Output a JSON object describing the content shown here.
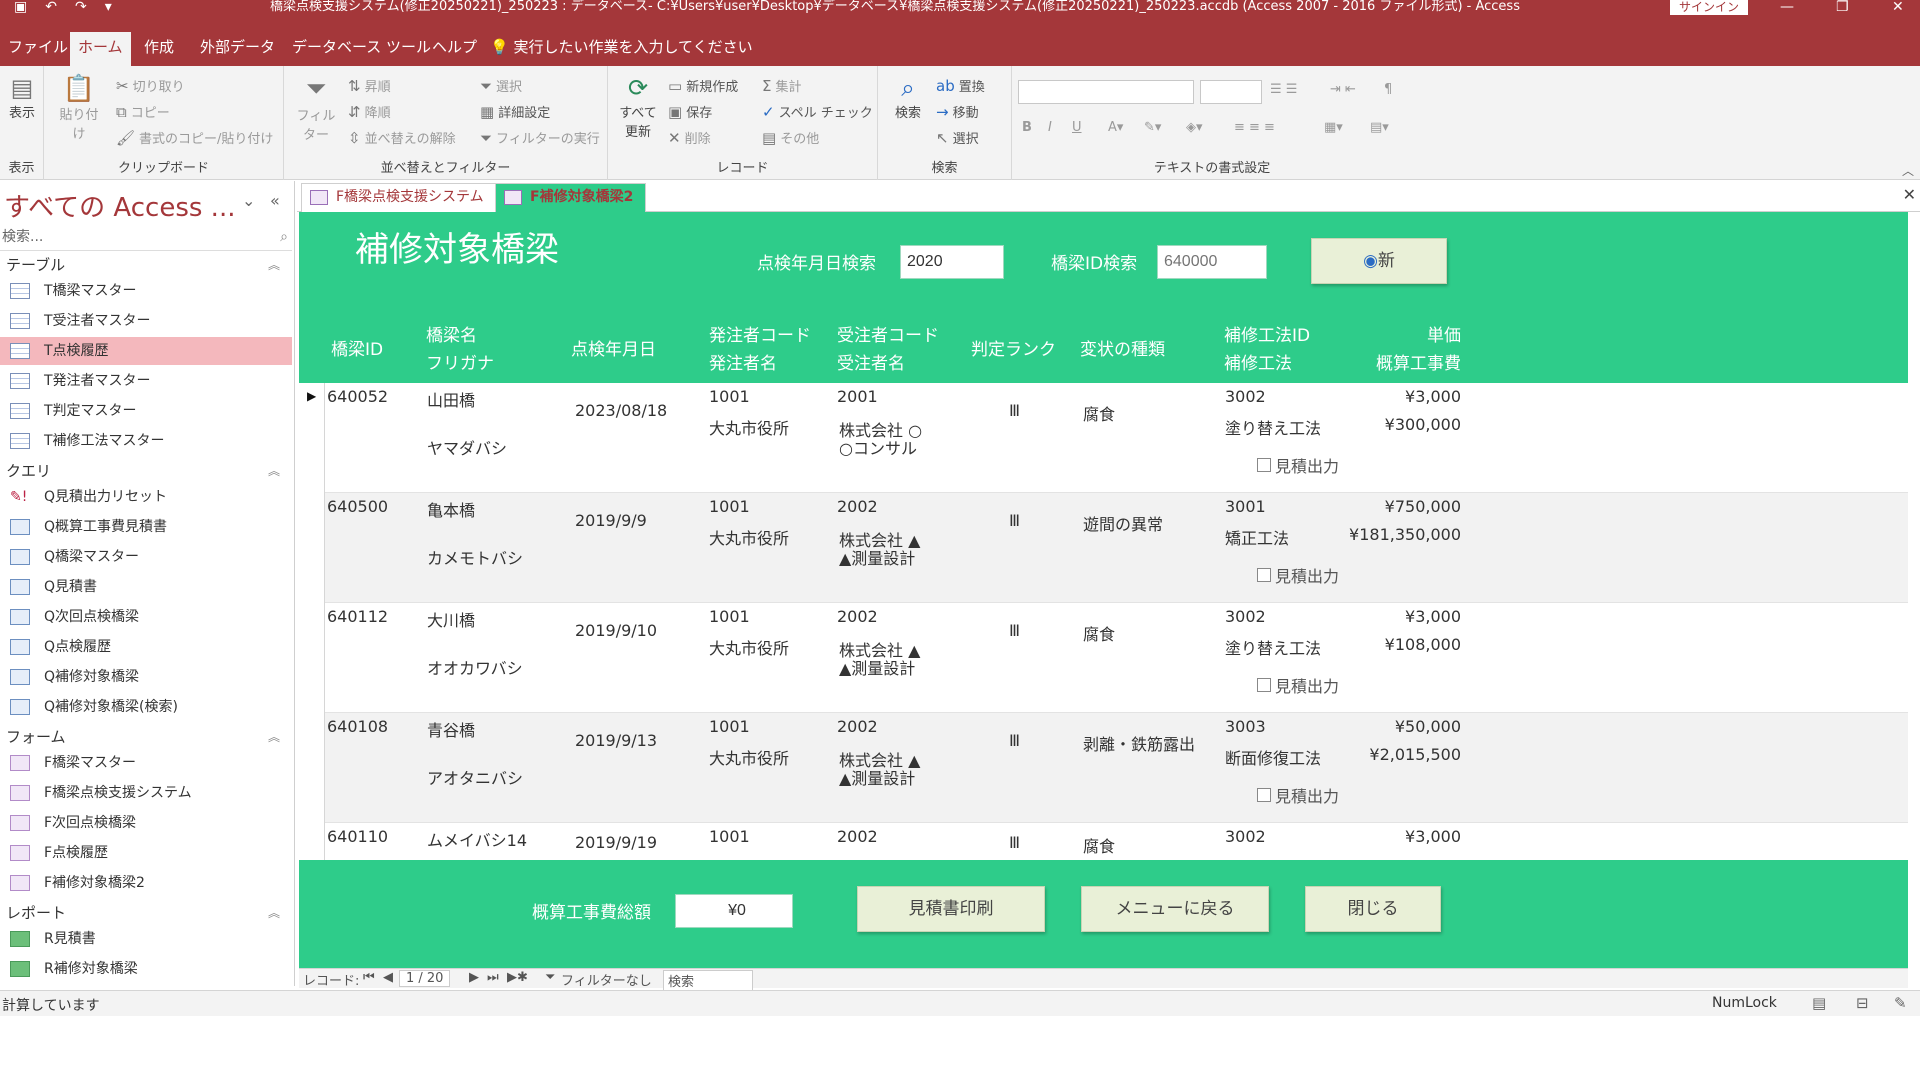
{
  "titlebar": {
    "title": "橋梁点検支援システム(修正20250221)_250223 : データベース- C:¥Users¥user¥Desktop¥データベース¥橋梁点検支援システム(修正20250221)_250223.accdb (Access 2007 - 2016 ファイル形式)  -  Access",
    "signin": "サインイン"
  },
  "menu": {
    "tabs": [
      "ファイル",
      "ホーム",
      "作成",
      "外部データ",
      "データベース ツール",
      "ヘルプ"
    ],
    "active": "ホーム",
    "tell_me": "実行したい作業を入力してください"
  },
  "ribbon": {
    "view": "表示",
    "paste": "貼り付け",
    "cut": "切り取り",
    "copy": "コピー",
    "format_painter": "書式のコピー/貼り付け",
    "filter": "フィルター",
    "ascending": "昇順",
    "descending": "降順",
    "remove_sort": "並べ替えの解除",
    "selection": "選択",
    "advanced": "詳細設定",
    "toggle_filter": "フィルターの実行",
    "refresh_all_1": "すべて",
    "refresh_all_2": "更新",
    "new": "新規作成",
    "save": "保存",
    "delete": "削除",
    "totals": "集計",
    "spelling": "スペル チェック",
    "more": "その他",
    "find": "検索",
    "replace": "置換",
    "goto": "移動",
    "select": "選択",
    "bold": "B",
    "italic": "I",
    "underline": "U",
    "groups": {
      "views": "表示",
      "clipboard": "クリップボード",
      "sort_filter": "並べ替えとフィルター",
      "records": "レコード",
      "find": "検索",
      "text_format": "テキストの書式設定"
    }
  },
  "nav": {
    "title": "すべての Access ...",
    "search_placeholder": "検索...",
    "sections": [
      {
        "label": "テーブル",
        "items": [
          "T橋梁マスター",
          "T受注者マスター",
          "T点検履歴",
          "T発注者マスター",
          "T判定マスター",
          "T補修工法マスター"
        ]
      },
      {
        "label": "クエリ",
        "items": [
          "Q見積出力リセット",
          "Q概算工事費見積書",
          "Q橋梁マスター",
          "Q見積書",
          "Q次回点検橋梁",
          "Q点検履歴",
          "Q補修対象橋梁",
          "Q補修対象橋梁(検索)"
        ]
      },
      {
        "label": "フォーム",
        "items": [
          "F橋梁マスター",
          "F橋梁点検支援システム",
          "F次回点検橋梁",
          "F点検履歴",
          "F補修対象橋梁2"
        ]
      },
      {
        "label": "レポート",
        "items": [
          "R見積書",
          "R補修対象橋梁"
        ]
      }
    ],
    "selected": "T点検履歴"
  },
  "doc_tabs": [
    {
      "label": "F橋梁点検支援システム",
      "active": false
    },
    {
      "label": "F補修対象橋梁2",
      "active": true
    }
  ],
  "form": {
    "title": "補修対象橋梁",
    "date_search_label": "点検年月日検索",
    "date_search_value": "2020",
    "id_search_label": "橋梁ID検索",
    "id_search_placeholder": "640000",
    "refresh_button": "新",
    "columns": {
      "bridge_id": "橋梁ID",
      "bridge_name": "橋梁名",
      "furigana": "フリガナ",
      "inspection_date": "点検年月日",
      "orderer_code": "発注者コード",
      "orderer_name": "発注者名",
      "contractor_code": "受注者コード",
      "contractor_name": "受注者名",
      "rank": "判定ランク",
      "defect": "変状の種類",
      "method_id": "補修工法ID",
      "method": "補修工法",
      "unit_price": "単価",
      "estimate": "概算工事費"
    },
    "estimate_checkbox": "見積出力",
    "rows": [
      {
        "id": "640052",
        "name": "山田橋",
        "furigana": "ヤマダバシ",
        "date": "2023/08/18",
        "orderer_code": "1001",
        "orderer": "大丸市役所",
        "contractor_code": "2001",
        "contractor_1": "株式会社 ○",
        "contractor_2": "○コンサル",
        "rank": "Ⅲ",
        "defect": "腐食",
        "method_id": "3002",
        "method": "塗り替え工法",
        "unit_price": "¥3,000",
        "estimate": "¥300,000"
      },
      {
        "id": "640500",
        "name": "亀本橋",
        "furigana": "カメモトバシ",
        "date": "2019/9/9",
        "orderer_code": "1001",
        "orderer": "大丸市役所",
        "contractor_code": "2002",
        "contractor_1": "株式会社 ▲",
        "contractor_2": "▲測量設計",
        "rank": "Ⅲ",
        "defect": "遊間の異常",
        "method_id": "3001",
        "method": "矯正工法",
        "unit_price": "¥750,000",
        "estimate": "¥181,350,000"
      },
      {
        "id": "640112",
        "name": "大川橋",
        "furigana": "オオカワバシ",
        "date": "2019/9/10",
        "orderer_code": "1001",
        "orderer": "大丸市役所",
        "contractor_code": "2002",
        "contractor_1": "株式会社 ▲",
        "contractor_2": "▲測量設計",
        "rank": "Ⅲ",
        "defect": "腐食",
        "method_id": "3002",
        "method": "塗り替え工法",
        "unit_price": "¥3,000",
        "estimate": "¥108,000"
      },
      {
        "id": "640108",
        "name": "青谷橋",
        "furigana": "アオタニバシ",
        "date": "2019/9/13",
        "orderer_code": "1001",
        "orderer": "大丸市役所",
        "contractor_code": "2002",
        "contractor_1": "株式会社 ▲",
        "contractor_2": "▲測量設計",
        "rank": "Ⅲ",
        "defect": "剥離・鉄筋露出",
        "method_id": "3003",
        "method": "断面修復工法",
        "unit_price": "¥50,000",
        "estimate": "¥2,015,500"
      },
      {
        "id": "640110",
        "name": "ムメイバシ14",
        "furigana": "",
        "date": "2019/9/19",
        "orderer_code": "1001",
        "orderer": "",
        "contractor_code": "2002",
        "contractor_1": "",
        "contractor_2": "",
        "rank": "Ⅲ",
        "defect": "腐食",
        "method_id": "3002",
        "method": "",
        "unit_price": "¥3,000",
        "estimate": ""
      }
    ],
    "total_label": "概算工事費総額",
    "total_value": "¥0",
    "print_button": "見積書印刷",
    "menu_button": "メニューに戻る",
    "close_button": "閉じる"
  },
  "record_nav": {
    "label": "レコード:",
    "current": "1 / 20",
    "filter": "フィルターなし",
    "search": "検索"
  },
  "status": {
    "left": "計算しています",
    "numlock": "NumLock"
  }
}
